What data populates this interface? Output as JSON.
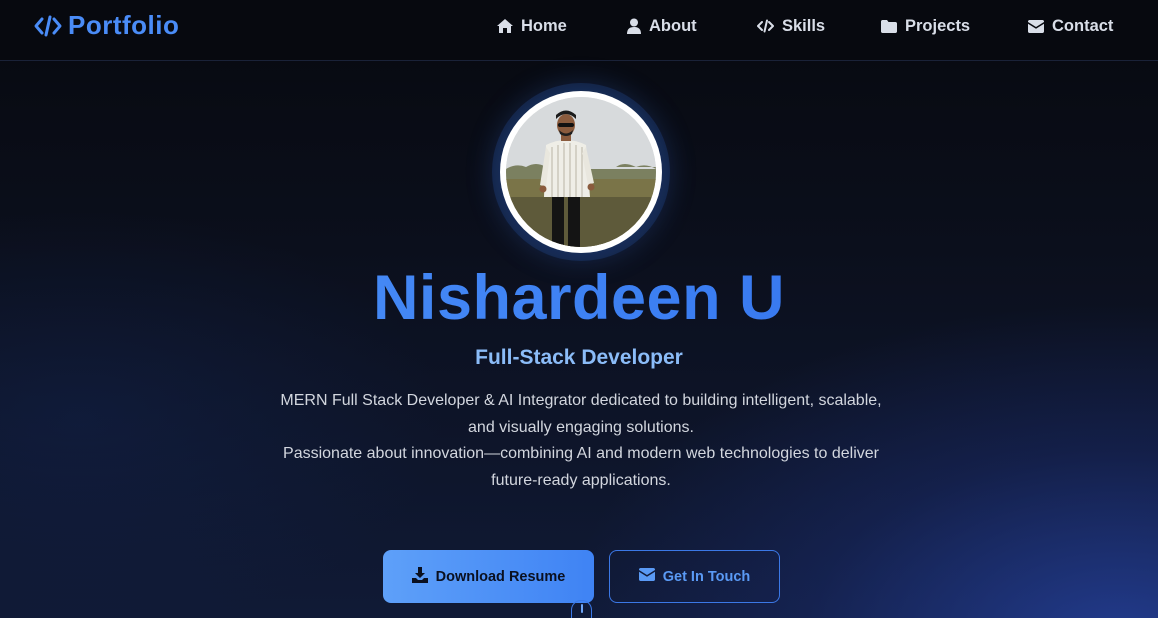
{
  "navbar": {
    "brand": "Portfolio",
    "brand_icon": "code-icon",
    "links": [
      {
        "label": "Home",
        "icon": "home-icon"
      },
      {
        "label": "About",
        "icon": "user-icon"
      },
      {
        "label": "Skills",
        "icon": "code-icon"
      },
      {
        "label": "Projects",
        "icon": "folder-icon"
      },
      {
        "label": "Contact",
        "icon": "envelope-icon"
      }
    ]
  },
  "hero": {
    "name": "Nishardeen U",
    "role": "Full-Stack Developer",
    "bio_line1": "MERN Full Stack Developer & AI Integrator dedicated to building intelligent, scalable, and visually engaging solutions.",
    "bio_line2": "Passionate about innovation—combining AI and modern web technologies to deliver future-ready applications.",
    "download_button": "Download Resume",
    "contact_button": "Get In Touch"
  },
  "colors": {
    "accent": "#4a8cf7",
    "accent_light": "#8bbcf8",
    "background": "#0b0e17",
    "nav_text": "#d9dee8"
  }
}
